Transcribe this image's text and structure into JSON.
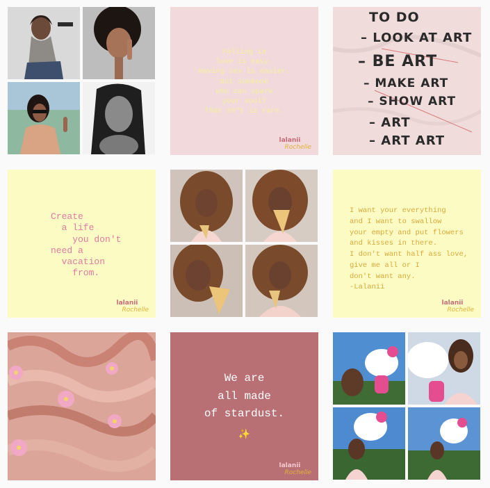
{
  "grid": {
    "background": "#fafafa",
    "posts": [
      {
        "id": "collage-zoe",
        "kind": "photo-collage"
      },
      {
        "id": "quote-love",
        "kind": "quote",
        "bg": "#f2d9dc",
        "color": "#fdf6a8",
        "text": "Falling in\nlove is easy.\nHaving sex is easier.\nBut someone\nwho can spark\nyour soul?\nThat sh*t is rare."
      },
      {
        "id": "todo-art",
        "kind": "photo",
        "lines": [
          "TO DO",
          "– LOOK AT ART",
          "– BE ART",
          "– MAKE ART",
          "– SHOW ART",
          "– ART",
          "– ART ART"
        ]
      },
      {
        "id": "quote-vacation",
        "kind": "quote",
        "bg": "#fdfbc4",
        "color": "#e07aa0",
        "text": "Create\n  a life\n    you don't\nneed a\n  vacation\n    from."
      },
      {
        "id": "collage-icecream",
        "kind": "photo-collage"
      },
      {
        "id": "quote-everything",
        "kind": "quote",
        "bg": "#fdfbc4",
        "color": "#d6a93a",
        "text": "I want your everything\nand I want to swallow\nyour empty and put flowers\nand kisses in there.\nI don't want half ass love,\ngive me all or I\ndon't want any.\n-Lalanii"
      },
      {
        "id": "pink-hair",
        "kind": "photo"
      },
      {
        "id": "quote-stardust",
        "kind": "quote",
        "bg": "#b87075",
        "color": "#ffffff",
        "text": "We are\nall made\nof stardust.",
        "emoji": "✨"
      },
      {
        "id": "collage-hellokitty",
        "kind": "photo-collage"
      }
    ],
    "logo": {
      "line1": "lalanii",
      "line2": "Rochelle"
    }
  }
}
